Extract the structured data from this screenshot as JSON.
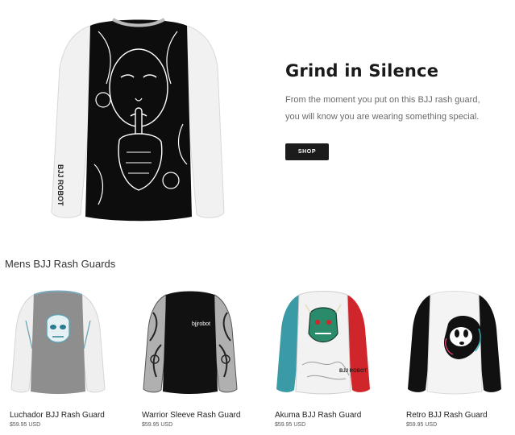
{
  "hero": {
    "title": "Grind in Silence",
    "description": "From the moment you put on this BJJ rash guard, you will know you are wearing something special.",
    "shop_label": "SHOP",
    "sleeve_brand": "BJJ ROBOT"
  },
  "section": {
    "heading": "Mens BJJ Rash Guards"
  },
  "products": [
    {
      "name": "Luchador BJJ Rash Guard",
      "price": "$59.95 USD"
    },
    {
      "name": "Warrior Sleeve Rash Guard",
      "price": "$59.95 USD"
    },
    {
      "name": "Akuma BJJ Rash Guard",
      "price": "$59.95 USD"
    },
    {
      "name": "Retro BJJ Rash Guard",
      "price": "$59.95 USD"
    }
  ],
  "colors": {
    "button": "#1c1c1c",
    "teal": "#3a9aa5",
    "red": "#d0262b"
  }
}
